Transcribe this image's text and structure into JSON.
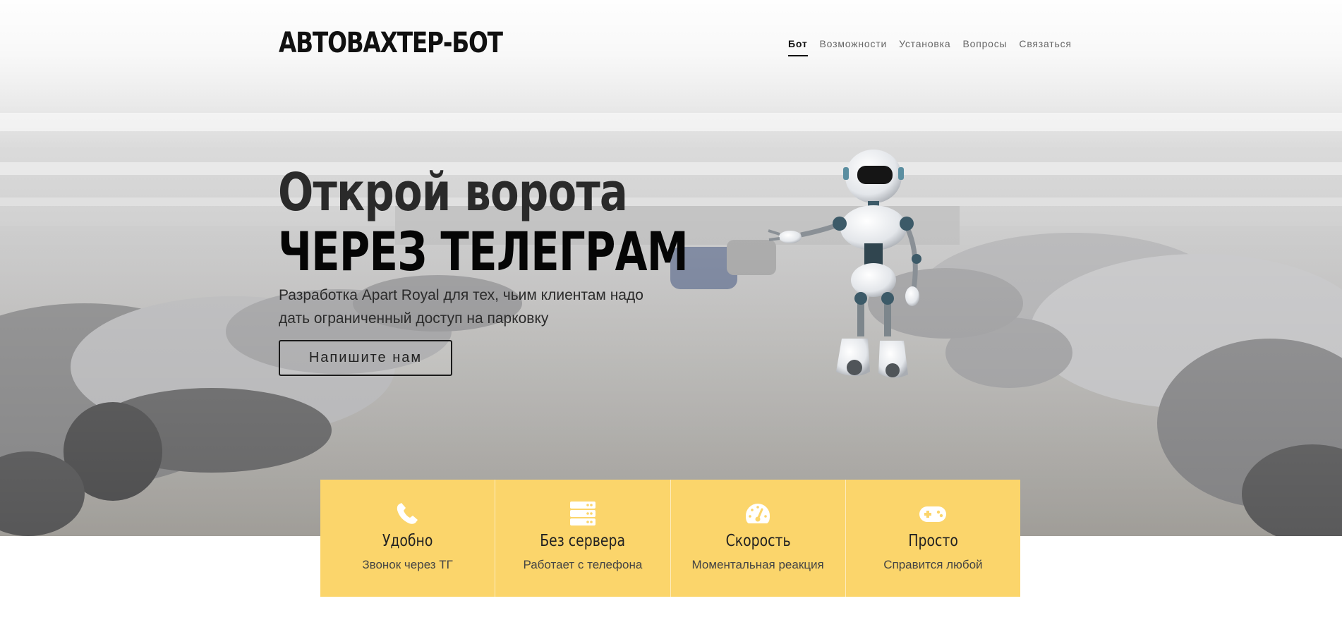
{
  "header": {
    "logo": "АВТОВАХТЕР-БОТ",
    "nav": [
      {
        "label": "Бот",
        "active": true
      },
      {
        "label": "Возможности",
        "active": false
      },
      {
        "label": "Установка",
        "active": false
      },
      {
        "label": "Вопросы",
        "active": false
      },
      {
        "label": "Связаться",
        "active": false
      }
    ]
  },
  "hero": {
    "title_line1": "Открой ворота",
    "title_line2": "ЧЕРЕЗ ТЕЛЕГРАМ",
    "subtitle": "Разработка Apart Royal для тех, чьим клиентам надо дать ограниченный доступ на парковку",
    "cta_label": "Напишите нам"
  },
  "features": [
    {
      "icon": "phone-icon",
      "title": "Удобно",
      "desc": "Звонок через ТГ"
    },
    {
      "icon": "server-icon",
      "title": "Без сервера",
      "desc": "Работает с телефона"
    },
    {
      "icon": "speedometer-icon",
      "title": "Скорость",
      "desc": "Моментальная реакция"
    },
    {
      "icon": "gamepad-icon",
      "title": "Просто",
      "desc": "Справится любой"
    }
  ],
  "colors": {
    "accent": "#fbd56b",
    "text_dark": "#111111"
  }
}
